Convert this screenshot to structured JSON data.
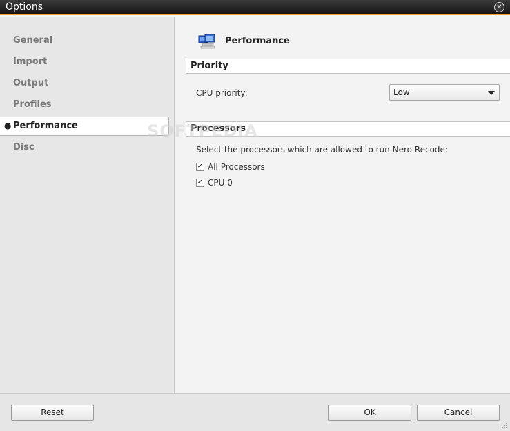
{
  "window": {
    "title": "Options",
    "close_glyph": "✕"
  },
  "sidebar": {
    "items": [
      {
        "label": "General",
        "active": false
      },
      {
        "label": "Import",
        "active": false
      },
      {
        "label": "Output",
        "active": false
      },
      {
        "label": "Profiles",
        "active": false
      },
      {
        "label": "Performance",
        "active": true
      },
      {
        "label": "Disc",
        "active": false
      }
    ]
  },
  "page": {
    "title": "Performance",
    "icon": "computers-icon",
    "priority_section": {
      "header": "Priority",
      "cpu_priority_label": "CPU priority:",
      "cpu_priority_value": "Low"
    },
    "processors_section": {
      "header": "Processors",
      "instruction": "Select the processors which are allowed to run Nero Recode:",
      "options": [
        {
          "label": "All Processors",
          "checked": true
        },
        {
          "label": "CPU 0",
          "checked": true
        }
      ]
    }
  },
  "watermark": "SOFTPEDIA",
  "footer": {
    "reset_label": "Reset",
    "ok_label": "OK",
    "cancel_label": "Cancel"
  },
  "colors": {
    "accent": "#f0a030",
    "titlebar": "#1e1e1e"
  }
}
